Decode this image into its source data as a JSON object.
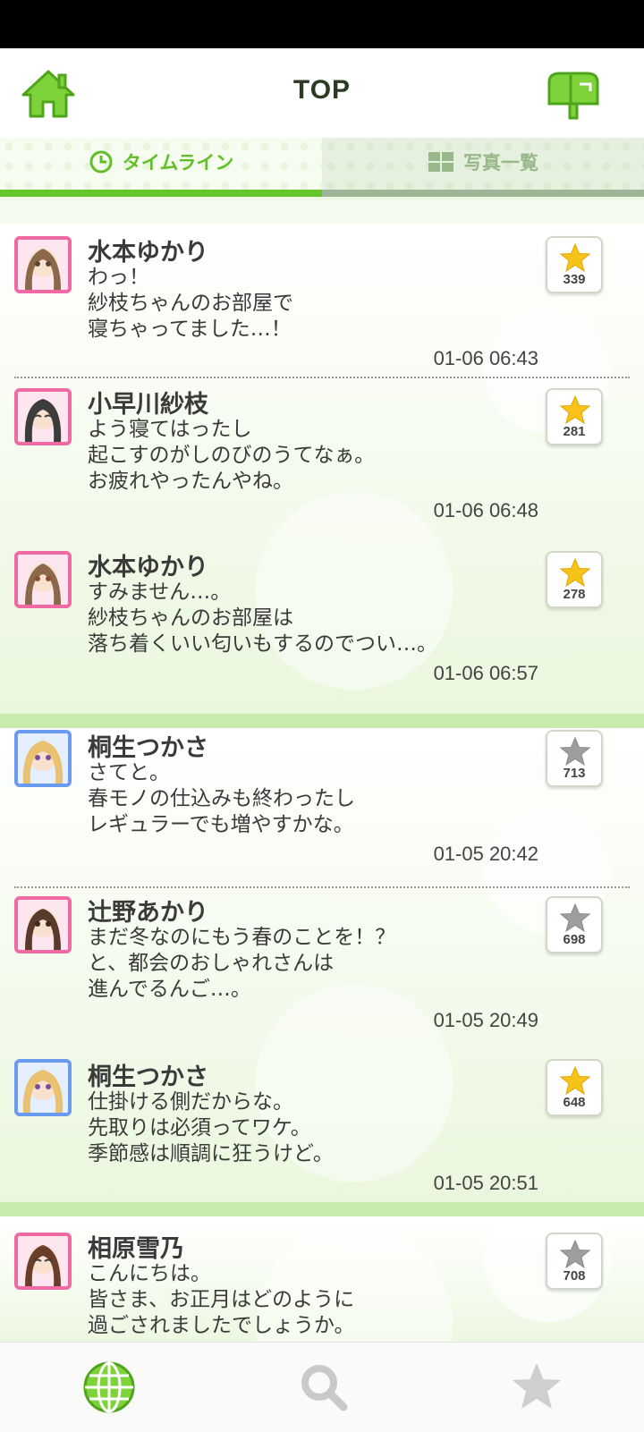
{
  "header": {
    "title": "TOP"
  },
  "tabs": [
    {
      "label": "タイムライン"
    },
    {
      "label": "写真一覧"
    }
  ],
  "colors": {
    "accent": "#66c42c",
    "star_active": "#f7c21a",
    "star_inactive": "#9e9e9e"
  },
  "posts": [
    {
      "name": "水本ゆかり",
      "message": "わっ！\n紗枝ちゃんのお部屋で\n寝ちゃってました…！",
      "time": "01-06 06:43",
      "likes": "339",
      "starred": true
    },
    {
      "name": "小早川紗枝",
      "message": "よう寝てはったし\n起こすのがしのびのうてなぁ。\nお疲れやったんやね。",
      "time": "01-06 06:48",
      "likes": "281",
      "starred": true
    },
    {
      "name": "水本ゆかり",
      "message": "すみません…。\n紗枝ちゃんのお部屋は\n落ち着くいい匂いもするのでつい…。",
      "time": "01-06 06:57",
      "likes": "278",
      "starred": true
    },
    {
      "name": "桐生つかさ",
      "message": "さてと。\n春モノの仕込みも終わったし\nレギュラーでも増やすかな。",
      "time": "01-05 20:42",
      "likes": "713",
      "starred": false
    },
    {
      "name": "辻野あかり",
      "message": "まだ冬なのにもう春のことを！？\nと、都会のおしゃれさんは\n進んでるんご…。",
      "time": "01-05 20:49",
      "likes": "698",
      "starred": false
    },
    {
      "name": "桐生つかさ",
      "message": "仕掛ける側だからな。\n先取りは必須ってワケ。\n季節感は順調に狂うけど。",
      "time": "01-05 20:51",
      "likes": "648",
      "starred": true
    },
    {
      "name": "相原雪乃",
      "message": "こんにちは。\n皆さま、お正月はどのように\n過ごされましたでしょうか。",
      "time": "",
      "likes": "708",
      "starred": false
    }
  ]
}
